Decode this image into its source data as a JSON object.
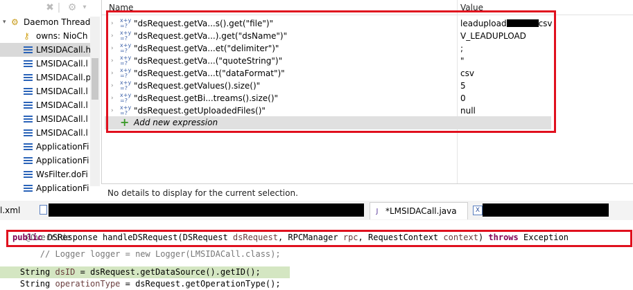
{
  "left_panel": {
    "toolbar_icons": [
      "remove-all-icon",
      "debug-view-icon"
    ],
    "threads": [
      {
        "label": "Daemon Thread",
        "kind": "thread",
        "icon": "thread-icon"
      },
      {
        "label": "owns: NioCh",
        "kind": "monitor",
        "icon": "key-icon"
      },
      {
        "label": "LMSIDACall.h",
        "kind": "frame",
        "selected": true
      },
      {
        "label": "LMSIDACall.l",
        "kind": "frame"
      },
      {
        "label": "LMSIDACall.p",
        "kind": "frame"
      },
      {
        "label": "LMSIDACall.l",
        "kind": "frame"
      },
      {
        "label": "LMSIDACall.l",
        "kind": "frame"
      },
      {
        "label": "LMSIDACall.l",
        "kind": "frame"
      },
      {
        "label": "LMSIDACall.l",
        "kind": "frame"
      },
      {
        "label": "ApplicationFi",
        "kind": "frame"
      },
      {
        "label": "ApplicationFi",
        "kind": "frame"
      },
      {
        "label": "WsFilter.doFi",
        "kind": "frame"
      },
      {
        "label": "ApplicationFi",
        "kind": "frame"
      }
    ]
  },
  "expressions": {
    "columns": {
      "name": "Name",
      "value": "Value"
    },
    "rows": [
      {
        "name": "\"dsRequest.getVa...s().get(\"file\")\"",
        "value_prefix": "leadupload",
        "value_suffix": "csv",
        "redacted": true
      },
      {
        "name": "\"dsRequest.getVa...).get(\"dsName\")\"",
        "value": "V_LEADUPLOAD"
      },
      {
        "name": "\"dsRequest.getVa...et(\"delimiter\")\"",
        "value": ";"
      },
      {
        "name": "\"dsRequest.getVa...(\"quoteString\")\"",
        "value": "\""
      },
      {
        "name": "\"dsRequest.getVa...t(\"dataFormat\")\"",
        "value": "csv"
      },
      {
        "name": "\"dsRequest.getValues().size()\"",
        "value": "5"
      },
      {
        "name": "\"dsRequest.getBi...treams().size()\"",
        "value": "0"
      },
      {
        "name": "\"dsRequest.getUploadedFiles()\"",
        "value": "null"
      }
    ],
    "add_label": "Add new expression"
  },
  "details": {
    "text": "No details to display for the current selection."
  },
  "tabs": [
    {
      "label": "l.xml",
      "icon": "xml-file-icon"
    },
    {
      "label": "*LMSIDACall.java",
      "icon": "java-file-icon",
      "active": true
    }
  ],
  "code": {
    "line1": "@Override",
    "line2_kw1": "public",
    "line2_a": " DSResponse handleDSRequest(DSRequest ",
    "line2_p1": "dsRequest",
    "line2_b": ", RPCManager ",
    "line2_p2": "rpc",
    "line2_c": ", RequestContext ",
    "line2_p3": "context",
    "line2_d": ") ",
    "line2_kw2": "throws",
    "line2_e": " Exception",
    "line3": "    // Logger logger = new Logger(LMSIDACall.class);",
    "line4": "",
    "line5_a": "    String ",
    "line5_b": "dsID",
    "line5_c": " = dsRequest.getDataSource().getID();",
    "line6_a": "    String ",
    "line6_b": "operationType",
    "line6_c": " = dsRequest.getOperationType();"
  },
  "colors": {
    "highlight_red": "#e0101e",
    "keyword": "#7f0055",
    "current_line": "#d4e6c2"
  }
}
